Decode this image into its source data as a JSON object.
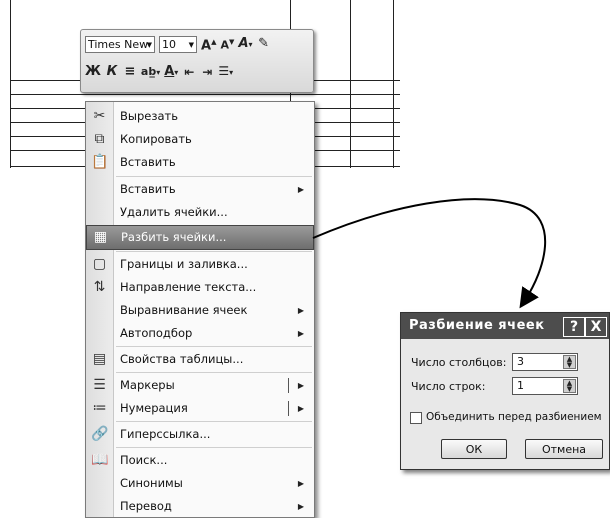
{
  "mini_toolbar": {
    "font_name": "Times New",
    "font_size": "10",
    "grow_font": "A",
    "shrink_font": "A",
    "bold": "Ж",
    "italic": "К",
    "font_color": "A"
  },
  "context_menu": {
    "items": [
      {
        "label": "Вырезать",
        "icon": "cut-icon"
      },
      {
        "label": "Копировать",
        "icon": "copy-icon"
      },
      {
        "label": "Вставить",
        "icon": "paste-icon"
      },
      {
        "label": "Вставить",
        "submenu": true
      },
      {
        "label": "Удалить ячейки..."
      },
      {
        "label": "Разбить ячейки...",
        "icon": "split-cells-icon",
        "highlighted": true
      },
      {
        "label": "Границы и заливка...",
        "icon": "borders-icon"
      },
      {
        "label": "Направление текста...",
        "icon": "text-direction-icon"
      },
      {
        "label": "Выравнивание ячеек",
        "submenu": true
      },
      {
        "label": "Автоподбор",
        "submenu": true
      },
      {
        "label": "Свойства таблицы...",
        "icon": "table-properties-icon"
      },
      {
        "label": "Маркеры",
        "icon": "bullets-icon",
        "submenu": true
      },
      {
        "label": "Нумерация",
        "icon": "numbering-icon",
        "submenu": true
      },
      {
        "label": "Гиперссылка...",
        "icon": "hyperlink-icon"
      },
      {
        "label": "Поиск...",
        "icon": "research-icon"
      },
      {
        "label": "Синонимы",
        "submenu": true
      },
      {
        "label": "Перевод",
        "submenu": true
      }
    ]
  },
  "dialog": {
    "title": "Разбиение ячеек",
    "help": "?",
    "close": "X",
    "columns_label": "Число столбцов:",
    "columns_value": "3",
    "rows_label": "Число строк:",
    "rows_value": "1",
    "merge_label": "Объединить перед разбиением",
    "merge_checked": false,
    "ok_label": "ОК",
    "cancel_label": "Отмена"
  },
  "colors": {
    "highlight": "#7a7a7a",
    "title_bar": "#4d4d4d"
  }
}
